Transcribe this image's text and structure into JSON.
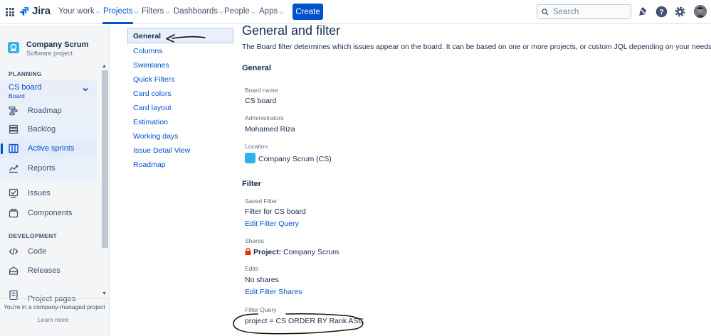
{
  "topnav": {
    "logo_text": "Jira",
    "items": [
      {
        "label": "Your work",
        "active": false
      },
      {
        "label": "Projects",
        "active": true
      },
      {
        "label": "Filters",
        "active": false
      },
      {
        "label": "Dashboards",
        "active": false
      },
      {
        "label": "People",
        "active": false
      },
      {
        "label": "Apps",
        "active": false
      }
    ],
    "create_label": "Create",
    "search_placeholder": "Search",
    "accent": "#0052cc"
  },
  "sidebar": {
    "project_name": "Company Scrum",
    "project_type": "Software project",
    "planning_heading": "PLANNING",
    "board_name": "CS board",
    "board_sub": "Board",
    "planning_items": [
      {
        "label": "Roadmap",
        "icon": "roadmap-icon"
      },
      {
        "label": "Backlog",
        "icon": "backlog-icon"
      },
      {
        "label": "Active sprints",
        "icon": "board-icon",
        "active": true
      },
      {
        "label": "Reports",
        "icon": "reports-icon"
      }
    ],
    "other_items": [
      {
        "label": "Issues",
        "icon": "issues-icon"
      },
      {
        "label": "Components",
        "icon": "components-icon"
      }
    ],
    "development_heading": "DEVELOPMENT",
    "dev_items": [
      {
        "label": "Code",
        "icon": "code-icon"
      },
      {
        "label": "Releases",
        "icon": "releases-icon"
      },
      {
        "label": "Project pages",
        "icon": "pages-icon"
      }
    ],
    "footer_text": "You're in a company-managed project",
    "footer_link": "Learn more"
  },
  "settings_menu": {
    "active": "General",
    "items": [
      "Columns",
      "Swimlanes",
      "Quick Filters",
      "Card colors",
      "Card layout",
      "Estimation",
      "Working days",
      "Issue Detail View",
      "Roadmap"
    ]
  },
  "main": {
    "title": "General and filter",
    "description": "The Board filter determines which issues appear on the board. It can be based on one or more projects, or custom JQL depending on your needs.",
    "general_heading": "General",
    "board_name_label": "Board name",
    "board_name_value": "CS board",
    "administrators_label": "Administrators",
    "administrators_value": "Mohamed Riza",
    "location_label": "Location",
    "location_value": "Company Scrum (CS)",
    "filter_heading": "Filter",
    "saved_filter_label": "Saved Filter",
    "saved_filter_value": "Filter for CS board",
    "edit_filter_query": "Edit Filter Query",
    "shares_label": "Shares",
    "shares_prefix": "Project:",
    "shares_value": "Company Scrum",
    "edits_label": "Edits",
    "edits_value": "No shares",
    "edit_filter_shares": "Edit Filter Shares",
    "filter_query_label": "Filter Query",
    "filter_query_value": "project = CS ORDER BY Rank ASC"
  }
}
